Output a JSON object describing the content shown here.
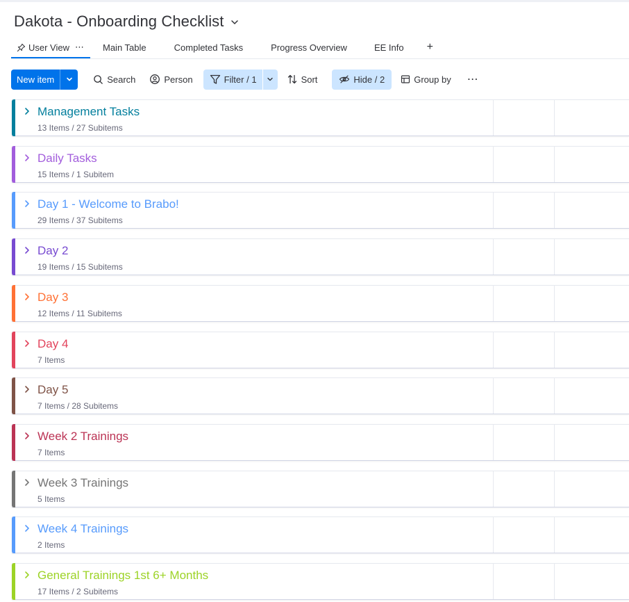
{
  "board": {
    "title": "Dakota - Onboarding Checklist"
  },
  "tabs": [
    {
      "label": "User View",
      "active": true
    },
    {
      "label": "Main Table"
    },
    {
      "label": "Completed Tasks"
    },
    {
      "label": "Progress Overview"
    },
    {
      "label": "EE Info"
    }
  ],
  "tab_add_label": "+",
  "toolbar": {
    "new_item": "New item",
    "search": "Search",
    "person": "Person",
    "filter": "Filter / 1",
    "sort": "Sort",
    "hide": "Hide / 2",
    "group_by": "Group by"
  },
  "groups": [
    {
      "name": "Management Tasks",
      "count": "13 Items / 27 Subitems",
      "color": "#037f9d"
    },
    {
      "name": "Daily Tasks",
      "count": "15 Items / 1 Subitem",
      "color": "#a25ddc"
    },
    {
      "name": "Day 1 - Welcome to Brabo!",
      "count": "29 Items / 37 Subitems",
      "color": "#579bfc"
    },
    {
      "name": "Day 2",
      "count": "19 Items / 15 Subitems",
      "color": "#784bd1"
    },
    {
      "name": "Day 3",
      "count": "12 Items / 11 Subitems",
      "color": "#ff7135"
    },
    {
      "name": "Day 4",
      "count": "7 Items",
      "color": "#e2445c"
    },
    {
      "name": "Day 5",
      "count": "7 Items / 28 Subitems",
      "color": "#7f5347"
    },
    {
      "name": "Week 2 Trainings",
      "count": "7 Items",
      "color": "#bb3354"
    },
    {
      "name": "Week 3 Trainings",
      "count": "5 Items",
      "color": "#757575"
    },
    {
      "name": "Week 4 Trainings",
      "count": "2 Items",
      "color": "#579bfc"
    },
    {
      "name": "General Trainings 1st 6+ Months",
      "count": "17 Items / 2 Subitems",
      "color": "#9cd326"
    }
  ]
}
